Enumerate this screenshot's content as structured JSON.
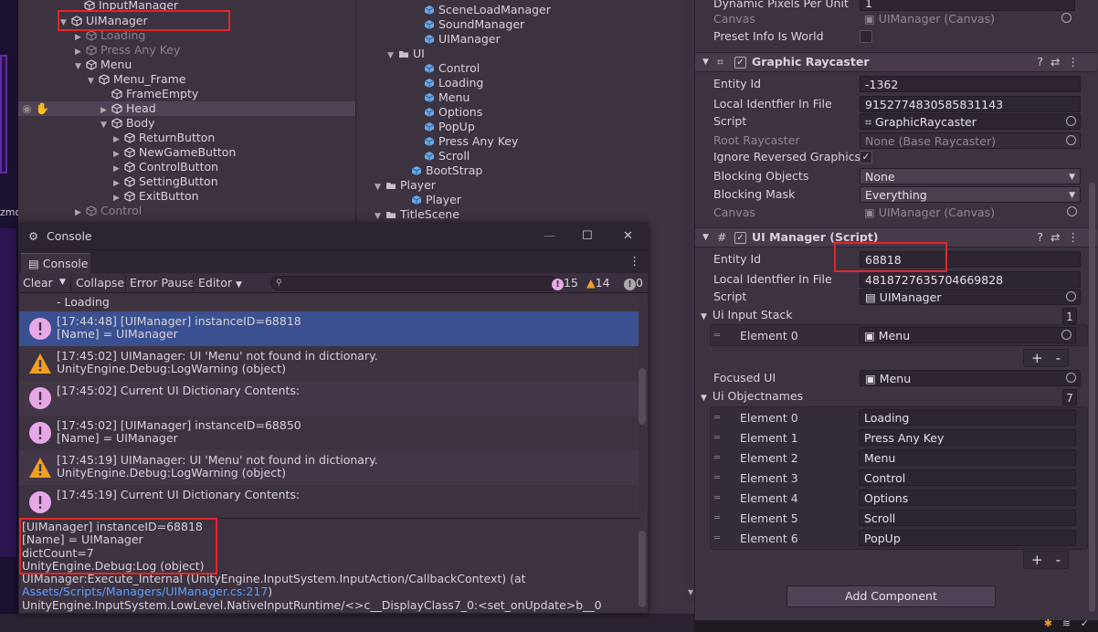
{
  "hierarchy_left": {
    "rows": [
      {
        "label": "InputManager",
        "dim": false
      },
      {
        "label": "UIManager",
        "dim": false
      },
      {
        "label": "Loading",
        "dim": true
      },
      {
        "label": "Press Any Key",
        "dim": true
      },
      {
        "label": "Menu",
        "dim": false
      },
      {
        "label": "Menu_Frame",
        "dim": false
      },
      {
        "label": "FrameEmpty",
        "dim": false
      },
      {
        "label": "Head",
        "dim": false
      },
      {
        "label": "Body",
        "dim": false
      },
      {
        "label": "ReturnButton",
        "dim": false
      },
      {
        "label": "NewGameButton",
        "dim": false
      },
      {
        "label": "ControlButton",
        "dim": false
      },
      {
        "label": "SettingButton",
        "dim": false
      },
      {
        "label": "ExitButton",
        "dim": false
      },
      {
        "label": "Control",
        "dim": true
      }
    ]
  },
  "hierarchy_right": {
    "rows": [
      {
        "label": "SceneLoadManager"
      },
      {
        "label": "SoundManager"
      },
      {
        "label": "UIManager"
      },
      {
        "label": "UI"
      },
      {
        "label": "Control"
      },
      {
        "label": "Loading"
      },
      {
        "label": "Menu"
      },
      {
        "label": "Options"
      },
      {
        "label": "PopUp"
      },
      {
        "label": "Press Any Key"
      },
      {
        "label": "Scroll"
      },
      {
        "label": "BootStrap"
      },
      {
        "label": "Player"
      },
      {
        "label": "Player"
      },
      {
        "label": "TitleScene"
      }
    ]
  },
  "gizmo_label": "zmo",
  "console": {
    "window_title": "Console",
    "tab_label": "Console",
    "toolbar": {
      "clear": "Clear",
      "collapse": "Collapse",
      "error_pause": "Error Pause",
      "editor": "Editor",
      "info_count": "15",
      "warn_count": "14",
      "error_count": "0"
    },
    "partial_line": "- Loading",
    "logs": [
      {
        "type": "info",
        "line1": "[17:44:48] [UIManager] instanceID=68818",
        "line2": "[Name] = UIManager",
        "selected": true
      },
      {
        "type": "warn",
        "line1": "[17:45:02] UIManager: UI 'Menu' not found in dictionary.",
        "line2": "UnityEngine.Debug:LogWarning (object)",
        "selected": false
      },
      {
        "type": "info",
        "line1": "[17:45:02] Current UI Dictionary Contents:",
        "line2": "",
        "selected": false
      },
      {
        "type": "info",
        "line1": "[17:45:02] [UIManager] instanceID=68850",
        "line2": "[Name] = UIManager",
        "selected": false
      },
      {
        "type": "warn",
        "line1": "[17:45:19] UIManager: UI 'Menu' not found in dictionary.",
        "line2": "UnityEngine.Debug:LogWarning (object)",
        "selected": false
      },
      {
        "type": "info",
        "line1": "[17:45:19] Current UI Dictionary Contents:",
        "line2": "",
        "selected": false
      }
    ],
    "detail": {
      "lines": [
        "[UIManager] instanceID=68818",
        "[Name] = UIManager",
        "dictCount=7",
        "UnityEngine.Debug:Log (object)",
        "UIManager:Execute_Internal (UnityEngine.InputSystem.InputAction/CallbackContext) (at"
      ],
      "link": "Assets/Scripts/Managers/UIManager.cs:217",
      "link_suffix": ")",
      "last_line": "UnityEngine.InputSystem.LowLevel.NativeInputRuntime/<>c__DisplayClass7_0:<set_onUpdate>b__0"
    }
  },
  "inspector": {
    "top": {
      "dyn_label": "Dynamic Pixels Per Unit",
      "dyn_value": "1",
      "canvas_label": "Canvas",
      "canvas_value": "UIManager (Canvas)",
      "preset_label": "Preset Info Is World"
    },
    "raycaster": {
      "title": "Graphic Raycaster",
      "entity_label": "Entity Id",
      "entity_value": "-1362",
      "lid_label": "Local Identfier In File",
      "lid_value": "9152774830585831143",
      "script_label": "Script",
      "script_value": "GraphicRaycaster",
      "root_label": "Root Raycaster",
      "root_value": "None (Base Raycaster)",
      "ignore_label": "Ignore Reversed Graphics",
      "blocking_obj_label": "Blocking Objects",
      "blocking_obj_value": "None",
      "blocking_mask_label": "Blocking Mask",
      "blocking_mask_value": "Everything",
      "canvas_label": "Canvas",
      "canvas_value": "UIManager (Canvas)"
    },
    "uimanager": {
      "title": "UI Manager (Script)",
      "entity_label": "Entity Id",
      "entity_value": "68818",
      "lid_label": "Local Identfier In File",
      "lid_value": "4818727635704669828",
      "script_label": "Script",
      "script_value": "UIManager",
      "stack_label": "Ui Input Stack",
      "stack_count": "1",
      "stack_items": [
        {
          "label": "Element 0",
          "value": "Menu"
        }
      ],
      "focused_label": "Focused UI",
      "focused_value": "Menu",
      "names_label": "Ui Objectnames",
      "names_count": "7",
      "names_items": [
        {
          "label": "Element 0",
          "value": "Loading"
        },
        {
          "label": "Element 1",
          "value": "Press Any Key"
        },
        {
          "label": "Element 2",
          "value": "Menu"
        },
        {
          "label": "Element 3",
          "value": "Control"
        },
        {
          "label": "Element 4",
          "value": "Options"
        },
        {
          "label": "Element 5",
          "value": "Scroll"
        },
        {
          "label": "Element 6",
          "value": "PopUp"
        }
      ]
    },
    "add_component": "Add Component"
  },
  "colors": {
    "highlight_red": "#e2262a",
    "selection_blue": "#3a5090",
    "info_icon": "#e8a8e8",
    "warn_icon": "#f0a020"
  }
}
